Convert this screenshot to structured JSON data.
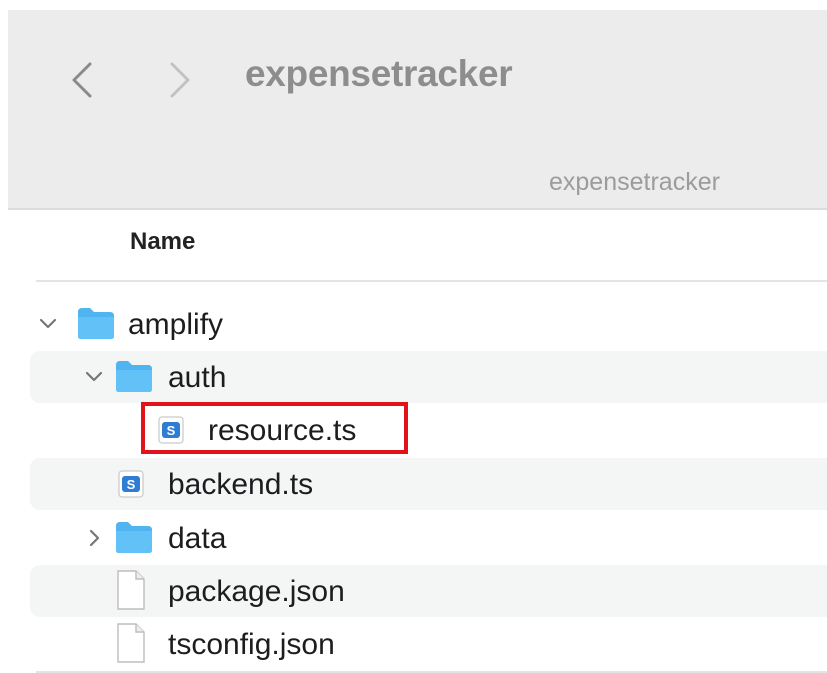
{
  "window": {
    "title": "expensetracker",
    "path_label": "expensetracker"
  },
  "columns": {
    "name": "Name"
  },
  "files": [
    {
      "name": "amplify",
      "type": "folder",
      "expanded": true
    },
    {
      "name": "auth",
      "type": "folder",
      "expanded": true
    },
    {
      "name": "resource.ts",
      "type": "typescript-file",
      "highlighted": true
    },
    {
      "name": "backend.ts",
      "type": "typescript-file"
    },
    {
      "name": "data",
      "type": "folder",
      "expanded": false
    },
    {
      "name": "package.json",
      "type": "document-file"
    },
    {
      "name": "tsconfig.json",
      "type": "document-file"
    }
  ],
  "colors": {
    "highlight": "#e0131b",
    "folder": "#4fb4f0",
    "ts_badge": "#2f7dd3"
  }
}
